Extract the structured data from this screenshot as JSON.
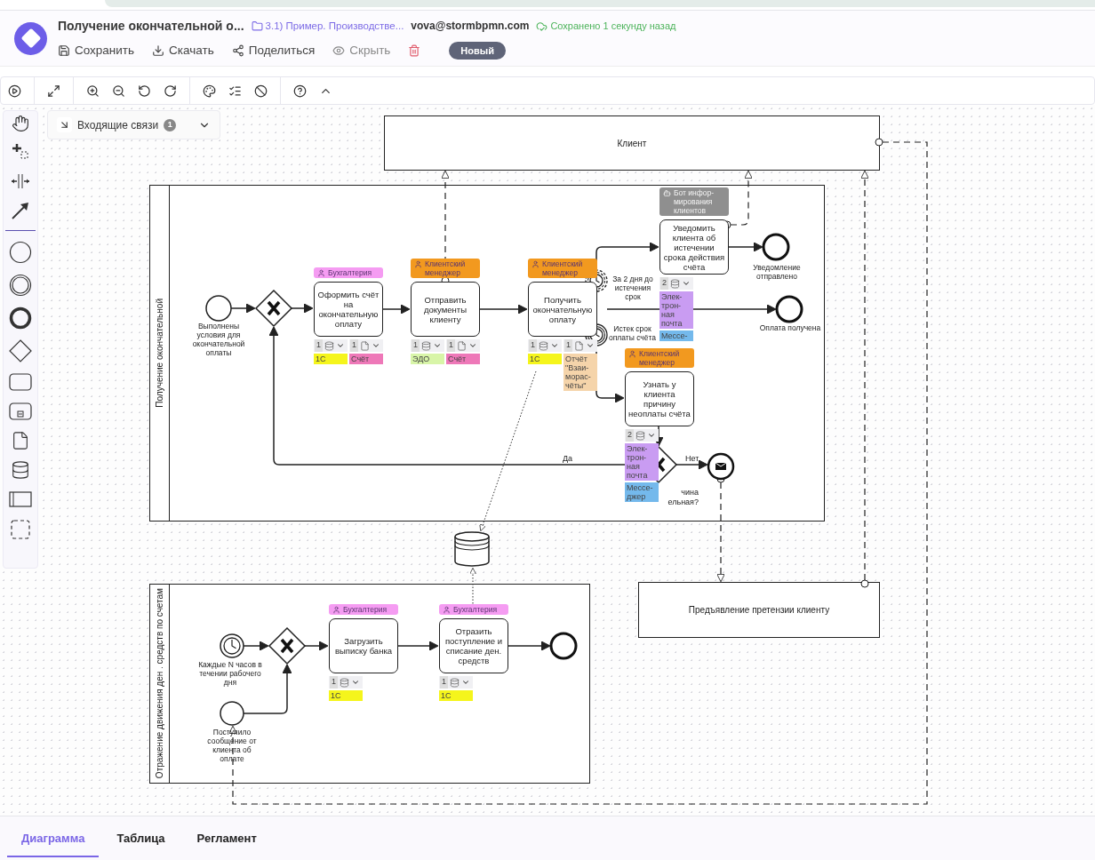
{
  "header": {
    "title": "Получение окончательной о...",
    "folder": "3.1) Пример. Производстве...",
    "user": "vova@stormbpmn.com",
    "save_status": "Сохранено 1 секунду назад",
    "status_badge": "Новый"
  },
  "actions": [
    {
      "label": "Сохранить",
      "kind": "save",
      "disabled": false
    },
    {
      "label": "Скачать",
      "kind": "download",
      "disabled": false
    },
    {
      "label": "Поделиться",
      "kind": "share",
      "disabled": false
    },
    {
      "label": "Скрыть",
      "kind": "hide",
      "disabled": true
    }
  ],
  "incoming_links": {
    "label": "Входящие связи",
    "count": "1"
  },
  "diagram": {
    "pools": [
      {
        "name": "Клиент",
        "kind": "collapsed"
      },
      {
        "name": "Получение окончательной",
        "kind": "expanded"
      },
      {
        "name": "Предъявление претензии клиенту",
        "kind": "collapsed"
      },
      {
        "name": "Отражение движения ден . средств по счетам",
        "kind": "expanded"
      }
    ],
    "tasks": [
      {
        "text": "Оформить счёт на окончательную оплату",
        "performer": {
          "text": "Бухгалтерия",
          "kind": "person",
          "color": "#f59cf2"
        },
        "resources": [
          {
            "count": "1",
            "kind": "database",
            "tags": [
              {
                "text": "1С",
                "color": "#f5f51c"
              }
            ]
          },
          {
            "count": "1",
            "kind": "document",
            "tags": [
              {
                "text": "Счёт",
                "color": "#ee78b8"
              }
            ]
          }
        ]
      },
      {
        "text": "Отправить документы клиенту",
        "performer": {
          "text": "Клиентский менеджер",
          "kind": "person",
          "color": "#f2991f"
        },
        "resources": [
          {
            "count": "1",
            "kind": "database",
            "tags": [
              {
                "text": "ЭДО",
                "color": "#d8f5a8"
              }
            ]
          },
          {
            "count": "1",
            "kind": "document",
            "tags": [
              {
                "text": "Счёт",
                "color": "#ee78b8"
              }
            ]
          }
        ]
      },
      {
        "text": "Получить окончательную оплату",
        "performer": {
          "text": "Клиентский менеджер",
          "kind": "person",
          "color": "#f2991f"
        },
        "resources": [
          {
            "count": "1",
            "kind": "database",
            "tags": [
              {
                "text": "1С",
                "color": "#f5f51c"
              }
            ]
          },
          {
            "count": "1",
            "kind": "document",
            "tags": [
              {
                "text": "Отчёт\n\"Взаи-\nморас-\nчёты\"",
                "color": "#f5d4aa"
              }
            ]
          }
        ]
      },
      {
        "text": "Уведомить клиента об истечении срока действия счёта",
        "performer": {
          "text": "Бот инфор-\nмирования\nклиентов",
          "kind": "bot",
          "color": "#8f8f8f"
        },
        "resources": [
          {
            "count": "2",
            "kind": "database",
            "tags": [
              {
                "text": "Элек-\nтрон-\nная\nпочта",
                "color": "#c99cf2"
              },
              {
                "text": "Мессе-",
                "color": "#74b9ec"
              }
            ]
          }
        ]
      },
      {
        "text": "Узнать у клиента причину неоплаты счёта",
        "performer": {
          "text": "Клиентский менеджер",
          "kind": "person",
          "color": "#f2991f"
        },
        "resources": [
          {
            "count": "2",
            "kind": "database",
            "tags": [
              {
                "text": "Элек-\nтрон-\nная\nпочта",
                "color": "#c99cf2"
              },
              {
                "text": "Мессе-\nджер",
                "color": "#74b9ec"
              }
            ]
          }
        ]
      },
      {
        "text": "Загрузить выписку банка",
        "performer": {
          "text": "Бухгалтерия",
          "kind": "person",
          "color": "#f59cf2"
        },
        "resources": [
          {
            "count": "1",
            "kind": "database",
            "tags": [
              {
                "text": "1С",
                "color": "#f5f51c"
              }
            ]
          }
        ]
      },
      {
        "text": "Отразить поступление и списание ден. средств",
        "performer": {
          "text": "Бухгалтерия",
          "kind": "person",
          "color": "#f59cf2"
        },
        "resources": [
          {
            "count": "1",
            "kind": "database",
            "tags": [
              {
                "text": "1С",
                "color": "#f5f51c"
              }
            ]
          }
        ]
      }
    ],
    "events": [
      {
        "kind": "start",
        "label": "Выполнены условия для окончательной оплаты"
      },
      {
        "kind": "timer_boundary",
        "interrupting": false,
        "label": "За 2 дня до истечения срок"
      },
      {
        "kind": "timer_boundary",
        "interrupting": true,
        "label": "Истек срок оплаты счёта"
      },
      {
        "kind": "end",
        "label": "Уведомление отправлено"
      },
      {
        "kind": "end",
        "label": "Оплата получена"
      },
      {
        "kind": "message_throw"
      },
      {
        "kind": "timer_start",
        "label": "Каждые N часов в течении рабочего дня"
      },
      {
        "kind": "end"
      },
      {
        "kind": "start",
        "label": "Поступило сообщение от клиента об оплате"
      }
    ],
    "gateways": [
      {
        "kind": "exclusive"
      },
      {
        "kind": "exclusive",
        "label": "чина\nельная?"
      },
      {
        "kind": "exclusive"
      }
    ],
    "flow_labels": [
      "Да",
      "Нет"
    ]
  },
  "tabs": [
    {
      "label": "Диаграмма",
      "selected": true
    },
    {
      "label": "Таблица",
      "selected": false
    },
    {
      "label": "Регламент",
      "selected": false
    }
  ]
}
